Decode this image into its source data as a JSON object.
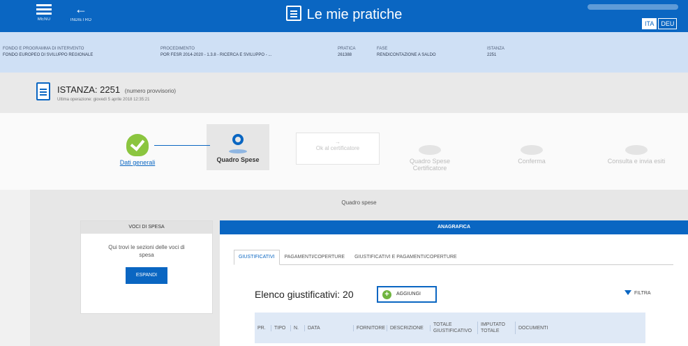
{
  "topbar": {
    "menu_label": "MENU",
    "back_label": "INDIETRO",
    "title": "Le mie pratiche",
    "languages": [
      "ITA",
      "DEU"
    ]
  },
  "info": [
    {
      "key": "FONDO E PROGRAMMA DI INTERVENTO",
      "value": "FONDO EUROPEO DI SVILUPPO REGIONALE"
    },
    {
      "key": "PROCEDIMENTO",
      "value": "POR FESR 2014-2020 - 1.3.8 - RICERCA E SVILUPPO - ..."
    },
    {
      "key": "PRATICA",
      "value": "261388"
    },
    {
      "key": "FASE",
      "value": "RENDICONTAZIONE A SALDO"
    },
    {
      "key": "ISTANZA",
      "value": "2251"
    }
  ],
  "istanza": {
    "title": "ISTANZA: 2251",
    "note": "(numero provvisorio)",
    "subtitle": "Ultima operazione: giovedì 5 aprile 2018 12:35:21"
  },
  "stepper": {
    "steps": [
      {
        "label": "Dati generali",
        "state": "done"
      },
      {
        "label": "Quadro Spese",
        "state": "active"
      },
      {
        "label": "Ok al certificatore",
        "state": "disabled"
      },
      {
        "label": "Quadro Spese Certificatore",
        "state": "disabled"
      },
      {
        "label": "Conferma",
        "state": "disabled"
      },
      {
        "label": "Consulta e invia esiti",
        "state": "disabled"
      }
    ]
  },
  "main": {
    "title": "Quadro spese",
    "voci": {
      "header": "VOCI DI SPESA",
      "text": "Qui trovi le sezioni delle voci di spesa",
      "button": "ESPANDI"
    },
    "anagrafica": {
      "header": "ANAGRAFICA",
      "tabs": [
        "GIUSTIFICATIVI",
        "PAGAMENTI/COPERTURE",
        "GIUSTIFICATIVI E PAGAMENTI/COPERTURE"
      ],
      "active_tab": "GIUSTIFICATIVI",
      "list_title": "Elenco giustificativi: 20",
      "add_button": "AGGIUNGI",
      "filter_button": "FILTRA",
      "columns": [
        "PR.",
        "TIPO",
        "N.",
        "DATA",
        "FORNITORE",
        "DESCRIZIONE",
        "TOTALE GIUSTIFICATIVO",
        "IMPUTATO TOTALE",
        "DOCUMENTI"
      ]
    }
  }
}
